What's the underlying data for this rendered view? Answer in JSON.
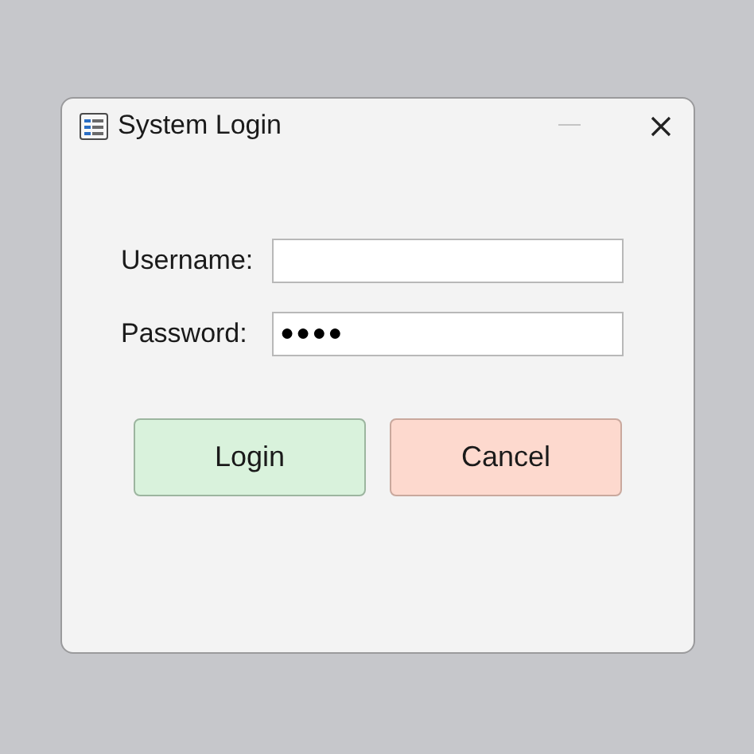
{
  "window": {
    "title": "System Login"
  },
  "fields": [
    {
      "label": "Username:"
    },
    {
      "label": "Password:",
      "value": "●●●●"
    }
  ],
  "buttons": [
    {
      "label": "Login",
      "kind": "confirm"
    },
    {
      "label": "Cancel",
      "kind": "cancel"
    }
  ]
}
